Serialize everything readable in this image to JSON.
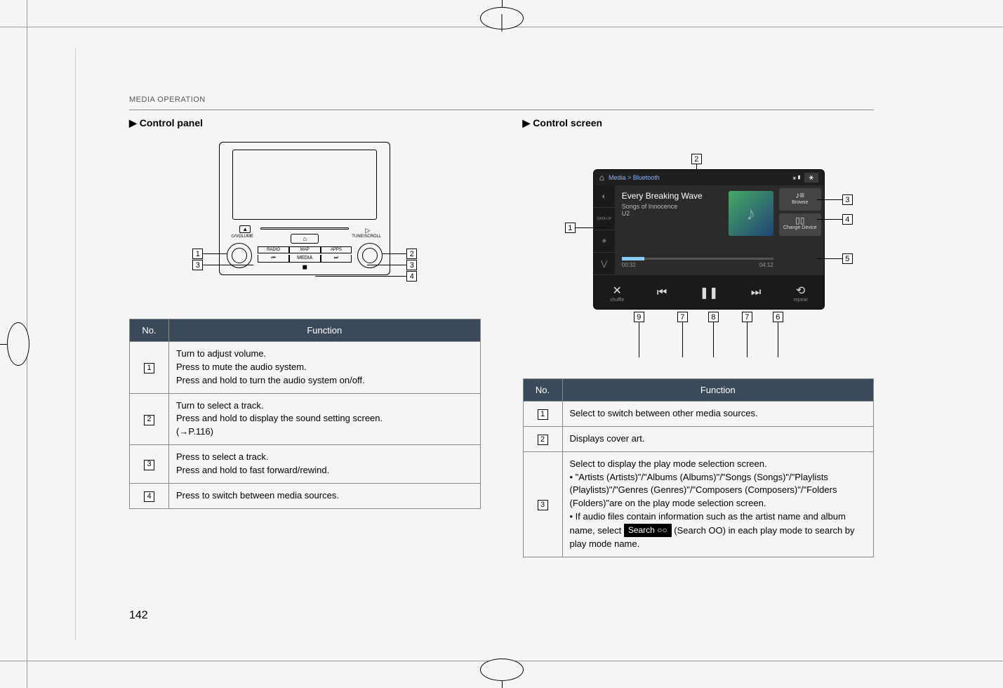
{
  "section": "MEDIA OPERATION",
  "left": {
    "heading": "Control panel",
    "panel": {
      "volume_label": "VOLUME",
      "tune_label": "TUNE/SCROLL",
      "eject": "▲",
      "slot_right": "▷",
      "home_glyph": "⌂",
      "buttons_row1": [
        "RADIO",
        "MAP",
        "APPS"
      ],
      "buttons_row2": [
        "⏮",
        "MEDIA",
        "⏭"
      ],
      "playback": "◼"
    },
    "table": {
      "head": [
        "No.",
        "Function"
      ],
      "rows": [
        {
          "num": "1",
          "text": "Turn to adjust volume.\nPress to mute the audio system.\nPress and hold to turn the audio system on/off."
        },
        {
          "num": "2",
          "text": "Turn to select a track.\nPress and hold to display the sound setting screen.\n(→P.116)"
        },
        {
          "num": "3",
          "text": "Press to select a track.\nPress and hold to fast forward/rewind."
        },
        {
          "num": "4",
          "text": "Press to switch between media sources."
        }
      ]
    }
  },
  "right": {
    "heading": "Control screen",
    "screen": {
      "breadcrumb": "Media > Bluetooth",
      "track_title": "Every Breaking Wave",
      "track_sub": "Songs of Innocence",
      "track_artist": "U2",
      "side_lbl": "DATA UP",
      "browse_label": "Browse",
      "change_label": "Change Device",
      "time_cur": "00:32",
      "time_total": "04:12",
      "shuffle_lbl": "shuffle",
      "repeat_lbl": "repeat"
    },
    "table": {
      "head": [
        "No.",
        "Function"
      ],
      "rows": [
        {
          "num": "1",
          "text": "Select to switch between other media sources."
        },
        {
          "num": "2",
          "text": "Displays cover art."
        },
        {
          "num": "3",
          "prefix": "Select to display the play mode selection screen.\n• \"Artists (Artists)\"/\"Albums (Albums)\"/\"Songs (Songs)\"/\"Playlists (Playlists)\"/\"Genres (Genres)\"/\"Composers (Composers)\"/\"Folders (Folders)\"are on the play mode selection screen.\n• If audio files contain information such as the artist name and album name, select ",
          "badge": "Search ○○",
          "suffix": " (Search OO) in each play mode to search by play mode name."
        }
      ]
    }
  },
  "page_number": "142"
}
